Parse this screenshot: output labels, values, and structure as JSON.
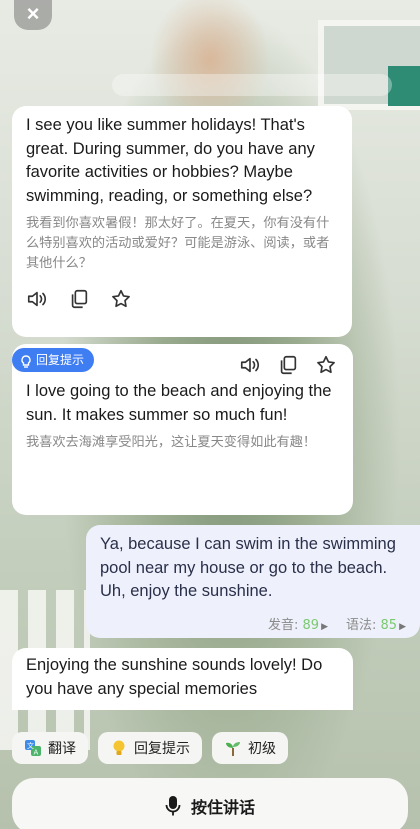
{
  "messages": {
    "ai_1": {
      "en": "I see you like summer holidays! That's great. During summer, do you have any favorite activities or hobbies? Maybe swimming, reading, or something else?",
      "zh": "我看到你喜欢暑假！那太好了。在夏天，你有没有什么特别喜欢的活动或爱好？可能是游泳、阅读，或者其他什么？",
      "icons": [
        "speaker-icon",
        "copy-icon",
        "star-icon"
      ]
    },
    "hint": {
      "tag_label": "回复提示",
      "en": "I love going to the beach and enjoying the sun. It makes summer so much fun!",
      "zh": "我喜欢去海滩享受阳光，这让夏天变得如此有趣！",
      "icons": [
        "speaker-icon",
        "copy-icon",
        "star-icon"
      ]
    },
    "user_1": {
      "en": "Ya, because I can swim in the swimming pool near my house or go to the beach. Uh, enjoy the sunshine.",
      "pronunciation_label": "发音:",
      "pronunciation_score": "89",
      "grammar_label": "语法:",
      "grammar_score": "85"
    },
    "ai_2": {
      "en": "Enjoying the sunshine sounds lovely! Do you have any special memories"
    }
  },
  "chips": {
    "translate_label": "翻译",
    "hint_label": "回复提示",
    "level_label": "初级"
  },
  "talk_button": {
    "label": "按住讲话"
  },
  "colors": {
    "accent_blue": "#3f7df3",
    "score_green": "#7bc96f",
    "user_bubble": "#eef1fb"
  }
}
